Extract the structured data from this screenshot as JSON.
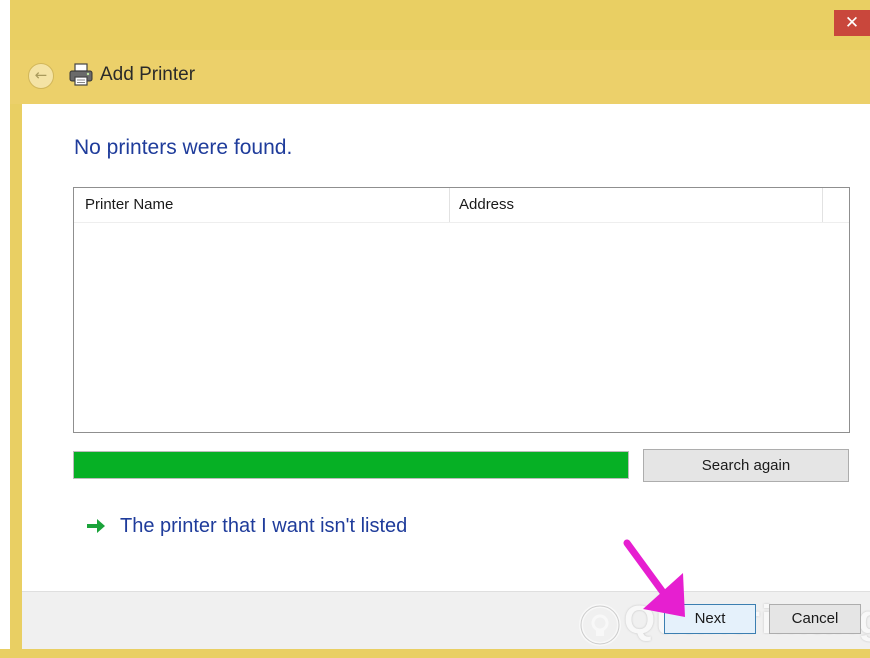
{
  "window": {
    "title": "Add Printer",
    "close_glyph": "✕",
    "back_glyph": "←"
  },
  "main": {
    "heading": "No printers were found.",
    "list": {
      "columns": [
        "Printer Name",
        "Address"
      ],
      "rows": []
    },
    "progress": {
      "value": 1.0,
      "color": "#06b025"
    },
    "search_again_label": "Search again",
    "not_listed_link": "The printer that I want isn't listed"
  },
  "footer": {
    "next_label": "Next",
    "cancel_label": "Cancel"
  },
  "watermark": {
    "text": "Quantrimang"
  },
  "icons": {
    "back": "back-arrow-icon",
    "printer": "printer-icon",
    "link_arrow": "green-right-arrow-icon",
    "pointer": "magenta-pointer-arrow-icon",
    "close": "close-icon"
  },
  "colors": {
    "frame": "#e9cf63",
    "heading": "#1f3c9b",
    "close": "#c9473c",
    "pointer": "#e61fd0"
  }
}
